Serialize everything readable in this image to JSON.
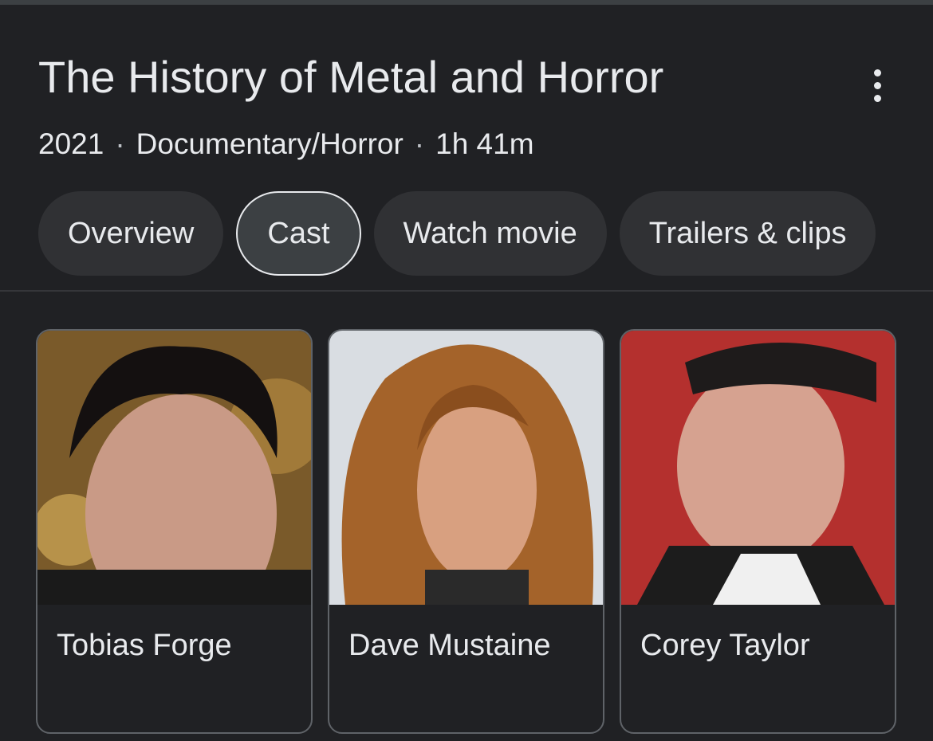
{
  "header": {
    "title": "The History of Metal and Horror",
    "year": "2021",
    "genre": "Documentary/Horror",
    "runtime": "1h 41m",
    "separator": "·"
  },
  "tabs": [
    {
      "label": "Overview",
      "active": false
    },
    {
      "label": "Cast",
      "active": true
    },
    {
      "label": "Watch movie",
      "active": false
    },
    {
      "label": "Trailers & clips",
      "active": false
    }
  ],
  "cast": [
    {
      "name": "Tobias Forge"
    },
    {
      "name": "Dave Mustaine"
    },
    {
      "name": "Corey Taylor"
    }
  ],
  "icons": {
    "more": "more-vert-icon"
  },
  "colors": {
    "background": "#202124",
    "chip": "#303134",
    "text": "#e8eaed",
    "card_border": "#5f6368"
  }
}
